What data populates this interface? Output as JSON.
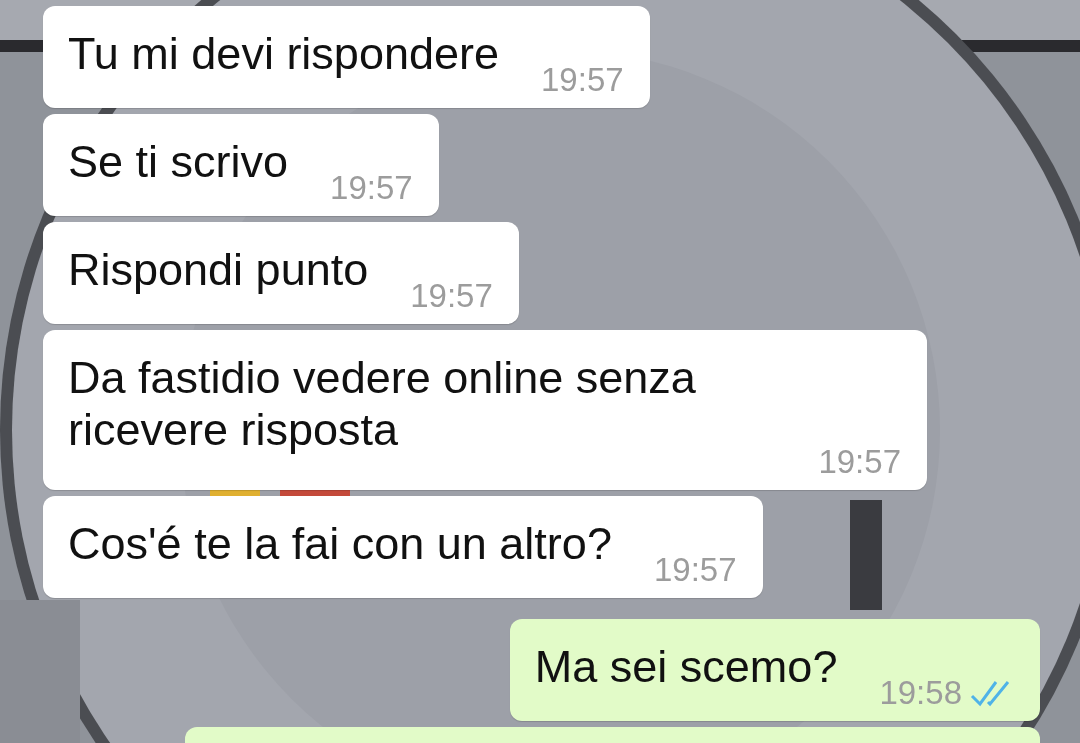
{
  "messages": [
    {
      "kind": "incoming",
      "text": "Tu mi devi rispondere",
      "time": "19:57"
    },
    {
      "kind": "incoming",
      "text": "Se ti scrivo",
      "time": "19:57"
    },
    {
      "kind": "incoming",
      "text": "Rispondi punto",
      "time": "19:57"
    },
    {
      "kind": "incoming",
      "text": "Da fastidio vedere online senza ricevere risposta",
      "time": "19:57"
    },
    {
      "kind": "incoming",
      "text": "Cos'é te la fai con un altro?",
      "time": "19:57"
    },
    {
      "kind": "outgoing",
      "text": "Ma sei scemo?",
      "time": "19:58",
      "read": true
    }
  ]
}
